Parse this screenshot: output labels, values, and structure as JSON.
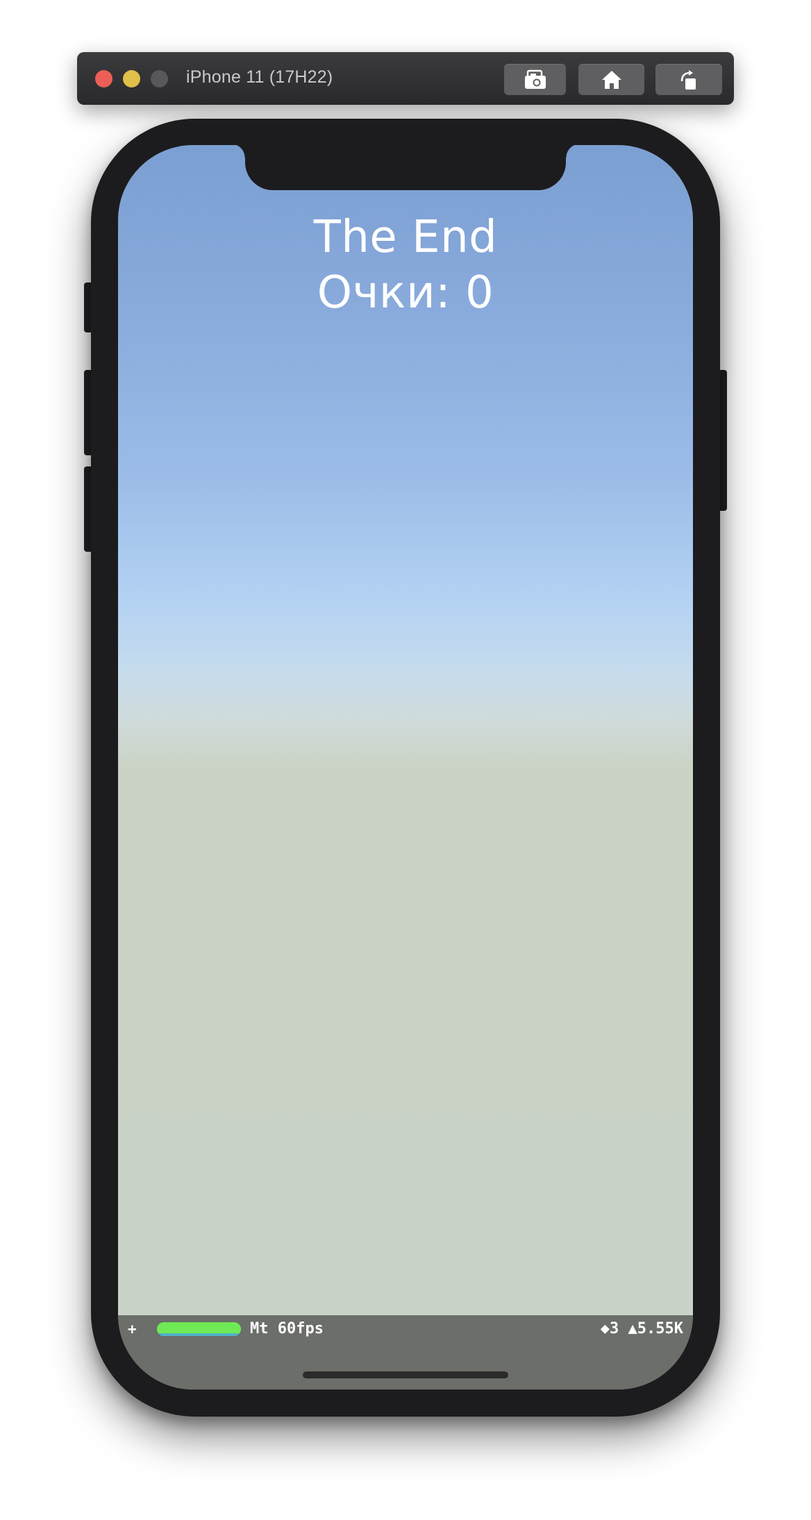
{
  "window": {
    "title": "iPhone 11 (17H22)",
    "toolbar": [
      {
        "name": "screenshot",
        "icon": "camera-icon"
      },
      {
        "name": "home",
        "icon": "home-icon"
      },
      {
        "name": "rotate",
        "icon": "rotate-icon"
      }
    ],
    "traffic_lights": {
      "close": "#ec5f57",
      "minimize": "#e1c04a",
      "zoom": "#58585a"
    }
  },
  "game": {
    "title": "The End",
    "score_text": "Очки: 0"
  },
  "stats": {
    "plus": "+",
    "fps_bar_level": 1.0,
    "fps_bar_color": "#6fe955",
    "fps_text": "Mt 60fps",
    "draw_stats": "◆3 ▲5.55K"
  }
}
